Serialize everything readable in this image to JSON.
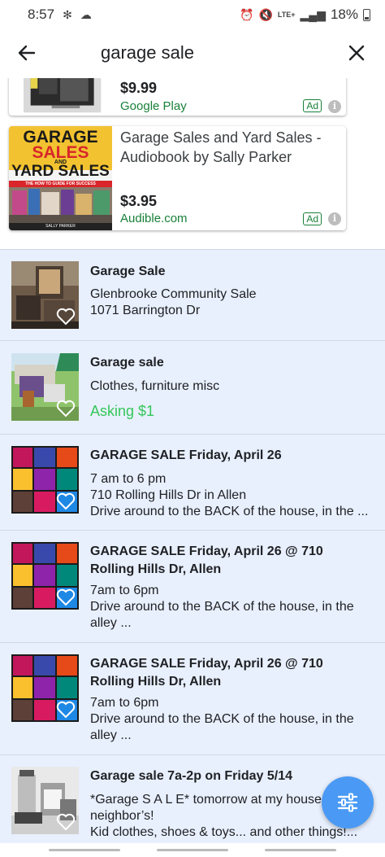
{
  "status_bar": {
    "time": "8:57",
    "network": "LTE+",
    "battery": "18%"
  },
  "search": {
    "query": "garage sale",
    "back_icon": "arrow-left-icon",
    "close_icon": "close-icon"
  },
  "ads": [
    {
      "title": "",
      "price": "$9.99",
      "source": "Google Play",
      "badge": "Ad"
    },
    {
      "title": "Garage Sales and Yard Sales - Audiobook by Sally Parker",
      "price": "$3.95",
      "source": "Audible.com",
      "badge": "Ad",
      "cover": {
        "line1": "GARAGE",
        "line2": "SALES",
        "line3": "AND",
        "line4": "YARD SALES",
        "line5": "THE HOW TO GUIDE FOR SUCCESS",
        "author": "SALLY PARKER"
      }
    }
  ],
  "listings": [
    {
      "title": "Garage Sale",
      "lines": [
        "Glenbrooke Community Sale",
        "1071 Barrington Dr"
      ],
      "price": ""
    },
    {
      "title": "Garage sale",
      "lines": [
        "Clothes, furniture misc"
      ],
      "price": "Asking $1"
    },
    {
      "title": "GARAGE SALE Friday, April 26",
      "lines": [
        "7 am to 6 pm",
        "710 Rolling Hills Dr in Allen",
        "Drive around to the BACK of the house, in the ..."
      ],
      "price": ""
    },
    {
      "title": "GARAGE SALE Friday, April 26 @ 710 Rolling Hills Dr, Allen",
      "lines": [
        "7am to 6pm",
        "Drive around to the BACK of the house, in the alley ..."
      ],
      "price": ""
    },
    {
      "title": "GARAGE SALE Friday, April 26 @ 710 Rolling Hills Dr, Allen",
      "lines": [
        "7am to 6pm",
        "Drive around to the BACK of the house, in the alley ..."
      ],
      "price": ""
    },
    {
      "title": "Garage sale 7a-2p on Friday 5/14",
      "lines": [
        "*Garage S A L E* tomorrow at my house",
        "neighbor’s!",
        "Kid clothes, shoes & toys... and other things!..."
      ],
      "price": ""
    }
  ],
  "fab": {
    "icon": "filter-sliders-icon"
  },
  "colors": {
    "accent": "#4a9af5",
    "ad_green": "#188038",
    "price_green": "#34c759",
    "listing_bg": "#e8f0fe"
  }
}
